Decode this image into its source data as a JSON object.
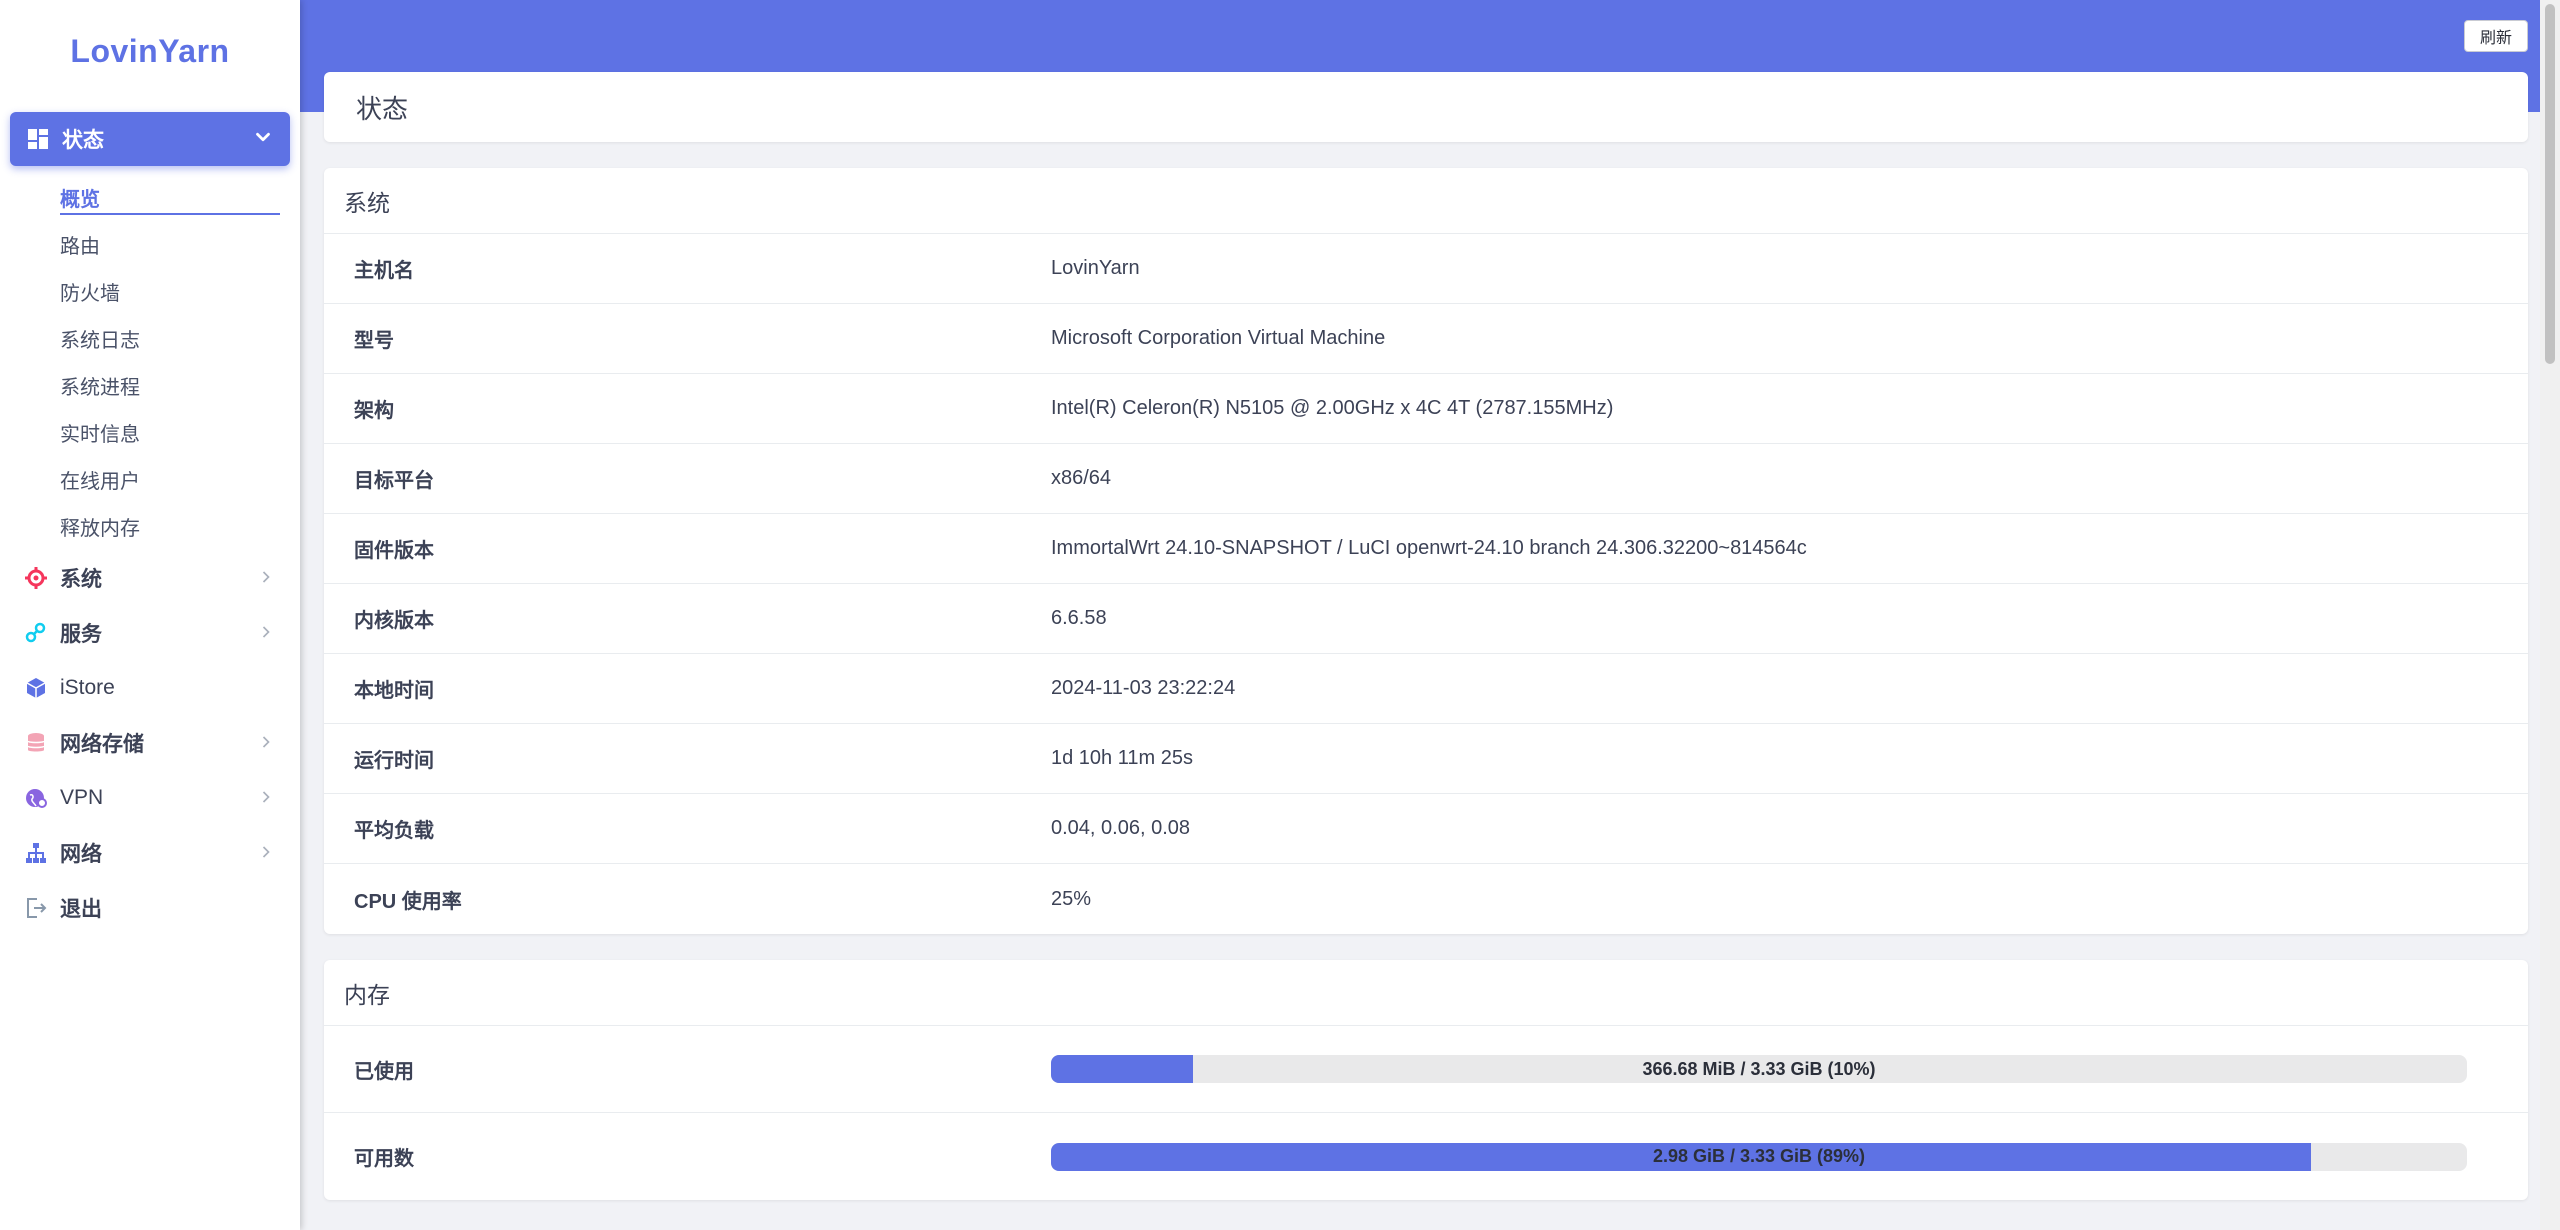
{
  "brand": "LovinYarn",
  "header": {
    "refresh_label": "刷新"
  },
  "sidebar": {
    "group": {
      "label": "状态",
      "icon": "dashboard-icon"
    },
    "subitems": [
      {
        "label": "概览",
        "active": true
      },
      {
        "label": "路由"
      },
      {
        "label": "防火墙"
      },
      {
        "label": "系统日志"
      },
      {
        "label": "系统进程"
      },
      {
        "label": "实时信息"
      },
      {
        "label": "在线用户"
      },
      {
        "label": "释放内存"
      }
    ],
    "menu": [
      {
        "label": "系统",
        "icon": "gear-icon",
        "icon_color": "#f5365c",
        "has_arrow": true
      },
      {
        "label": "服务",
        "icon": "services-icon",
        "icon_color": "#11cdef",
        "has_arrow": true
      },
      {
        "label": "iStore",
        "icon": "box-icon",
        "icon_color": "#5e72e4",
        "has_arrow": false
      },
      {
        "label": "网络存储",
        "icon": "database-icon",
        "icon_color": "#f3a4b5",
        "has_arrow": true
      },
      {
        "label": "VPN",
        "icon": "vpn-globe-icon",
        "icon_color": "#8965e0",
        "has_arrow": true
      },
      {
        "label": "网络",
        "icon": "network-tree-icon",
        "icon_color": "#5e72e4",
        "has_arrow": true
      },
      {
        "label": "退出",
        "icon": "logout-icon",
        "icon_color": "#8898aa",
        "has_arrow": false
      }
    ]
  },
  "page": {
    "title": "状态"
  },
  "system": {
    "header": "系统",
    "rows": [
      {
        "key": "主机名",
        "value": "LovinYarn"
      },
      {
        "key": "型号",
        "value": "Microsoft Corporation Virtual Machine"
      },
      {
        "key": "架构",
        "value": "Intel(R) Celeron(R) N5105 @ 2.00GHz x 4C 4T (2787.155MHz)"
      },
      {
        "key": "目标平台",
        "value": "x86/64"
      },
      {
        "key": "固件版本",
        "value": "ImmortalWrt 24.10-SNAPSHOT / LuCI openwrt-24.10 branch 24.306.32200~814564c"
      },
      {
        "key": "内核版本",
        "value": "6.6.58"
      },
      {
        "key": "本地时间",
        "value": "2024-11-03 23:22:24"
      },
      {
        "key": "运行时间",
        "value": "1d 10h 11m 25s"
      },
      {
        "key": "平均负载",
        "value": "0.04, 0.06, 0.08"
      },
      {
        "key": "CPU 使用率",
        "value": "25%"
      }
    ]
  },
  "memory": {
    "header": "内存",
    "rows": [
      {
        "key": "已使用",
        "label": "366.68 MiB / 3.33 GiB (10%)",
        "percent": 10
      },
      {
        "key": "可用数",
        "label": "2.98 GiB / 3.33 GiB (89%)",
        "percent": 89
      }
    ]
  },
  "colors": {
    "accent": "#5e72e4",
    "bar_track": "#e9e9ea"
  }
}
